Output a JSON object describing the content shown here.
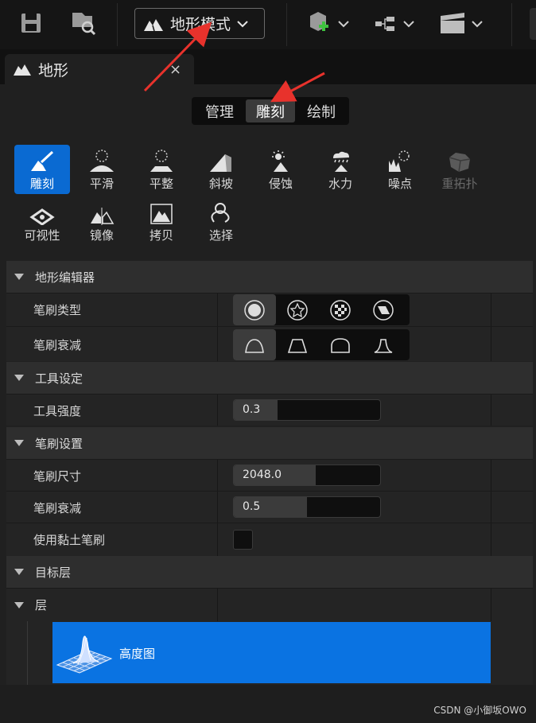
{
  "toolbar": {
    "mode_label": "地形模式",
    "icons": [
      "save-icon",
      "browse-icon",
      "landscape-icon",
      "add-actor-icon",
      "blueprint-icon",
      "cinematics-icon"
    ]
  },
  "tab": {
    "title": "地形",
    "close": "×"
  },
  "mode_tabs": [
    {
      "label": "管理",
      "active": false
    },
    {
      "label": "雕刻",
      "active": true
    },
    {
      "label": "绘制",
      "active": false
    }
  ],
  "tools": [
    {
      "label": "雕刻",
      "icon": "sculpt-icon",
      "active": true,
      "disabled": false
    },
    {
      "label": "平滑",
      "icon": "smooth-icon",
      "active": false,
      "disabled": false
    },
    {
      "label": "平整",
      "icon": "flatten-icon",
      "active": false,
      "disabled": false
    },
    {
      "label": "斜坡",
      "icon": "ramp-icon",
      "active": false,
      "disabled": false
    },
    {
      "label": "侵蚀",
      "icon": "erosion-icon",
      "active": false,
      "disabled": false
    },
    {
      "label": "水力",
      "icon": "hydro-icon",
      "active": false,
      "disabled": false
    },
    {
      "label": "噪点",
      "icon": "noise-icon",
      "active": false,
      "disabled": false
    },
    {
      "label": "重拓扑",
      "icon": "retopologize-icon",
      "active": false,
      "disabled": true
    },
    {
      "label": "可视性",
      "icon": "visibility-icon",
      "active": false,
      "disabled": false
    },
    {
      "label": "镜像",
      "icon": "mirror-icon",
      "active": false,
      "disabled": false
    },
    {
      "label": "拷贝",
      "icon": "copy-icon",
      "active": false,
      "disabled": false
    },
    {
      "label": "选择",
      "icon": "select-icon",
      "active": false,
      "disabled": false
    }
  ],
  "sections": {
    "editor": "地形编辑器",
    "tool_settings": "工具设定",
    "brush_settings": "笔刷设置",
    "target_layers": "目标层",
    "layers": "层"
  },
  "props": {
    "brush_type": "笔刷类型",
    "brush_falloff": "笔刷衰减",
    "tool_strength": "工具强度",
    "tool_strength_value": "0.3",
    "tool_strength_fill": 0.3,
    "brush_size": "笔刷尺寸",
    "brush_size_value": "2048.0",
    "brush_size_fill": 0.56,
    "falloff": "笔刷衰减",
    "falloff_value": "0.5",
    "falloff_fill": 0.5,
    "clay_brush": "使用黏土笔刷",
    "clay_brush_checked": false
  },
  "layer": {
    "name": "高度图"
  },
  "watermark": "CSDN @小御坂OWO",
  "colors": {
    "accent": "#0a73e2",
    "arrow": "#e8322c"
  }
}
